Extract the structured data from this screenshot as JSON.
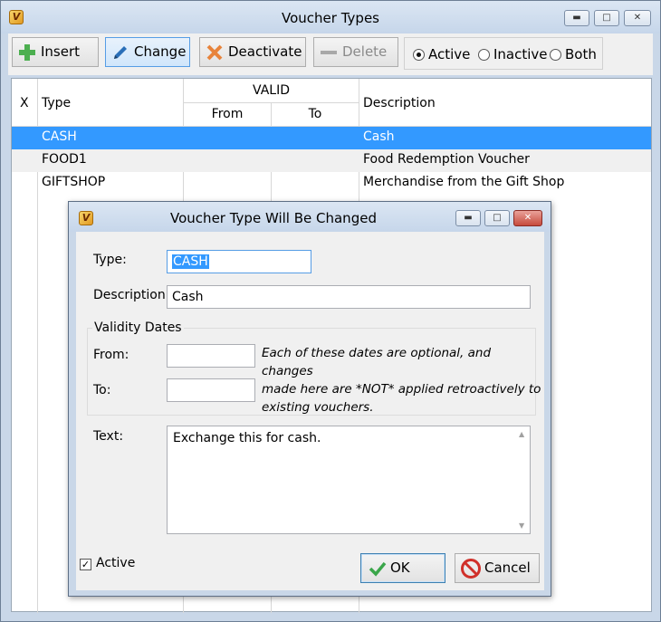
{
  "window": {
    "title": "Voucher Types"
  },
  "toolbar": {
    "insert": "Insert",
    "change": "Change",
    "deactivate": "Deactivate",
    "delete": "Delete",
    "filter": {
      "active": "Active",
      "inactive": "Inactive",
      "both": "Both",
      "selected": "Active"
    }
  },
  "grid": {
    "headers": {
      "x": "X",
      "type": "Type",
      "valid": "VALID",
      "from": "From",
      "to": "To",
      "description": "Description"
    },
    "rows": [
      {
        "type": "CASH",
        "from": "",
        "to": "",
        "description": "Cash"
      },
      {
        "type": "FOOD1",
        "from": "",
        "to": "",
        "description": "Food Redemption Voucher"
      },
      {
        "type": "GIFTSHOP",
        "from": "",
        "to": "",
        "description": "Merchandise from the Gift Shop"
      }
    ]
  },
  "dialog": {
    "title": "Voucher Type Will Be Changed",
    "type_label": "Type:",
    "type_value": "CASH",
    "description_label": "Description:",
    "description_value": "Cash",
    "validity_group": "Validity Dates",
    "from_label": "From:",
    "to_label": "To:",
    "from_value": "",
    "to_value": "",
    "hint_line1": "Each of these dates are optional, and changes",
    "hint_line2": "made here are *NOT* applied retroactively to",
    "hint_line3": "existing vouchers.",
    "text_label": "Text:",
    "text_value": "Exchange this for cash.",
    "active_label": "Active",
    "ok": "OK",
    "cancel": "Cancel"
  },
  "colors": {
    "selection": "#3399ff",
    "frame": "#c9d7e8"
  }
}
